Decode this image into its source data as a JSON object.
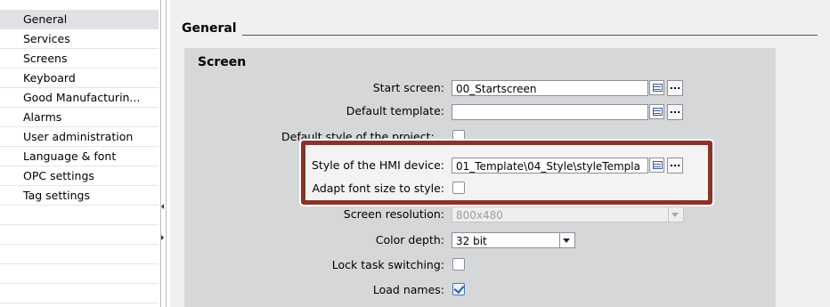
{
  "nav": {
    "items": [
      {
        "label": "General",
        "selected": true
      },
      {
        "label": "Services",
        "selected": false
      },
      {
        "label": "Screens",
        "selected": false
      },
      {
        "label": "Keyboard",
        "selected": false
      },
      {
        "label": "Good Manufacturin...",
        "selected": false
      },
      {
        "label": "Alarms",
        "selected": false
      },
      {
        "label": "User administration",
        "selected": false
      },
      {
        "label": "Language & font",
        "selected": false
      },
      {
        "label": "OPC settings",
        "selected": false
      },
      {
        "label": "Tag settings",
        "selected": false
      }
    ]
  },
  "content": {
    "section_title": "General",
    "panel_title": "Screen",
    "start_screen": {
      "label": "Start screen:",
      "value": "00_Startscreen"
    },
    "default_template": {
      "label": "Default template:",
      "value": ""
    },
    "default_style": {
      "label": "Default style of the project:",
      "checked": false
    },
    "style_hmi": {
      "label": "Style of the HMI device:",
      "value": "01_Template\\04_Style\\styleTempla"
    },
    "adapt_font": {
      "label": "Adapt font size to style:",
      "checked": false
    },
    "screen_resolution": {
      "label": "Screen resolution:",
      "value": "800x480",
      "disabled": true
    },
    "color_depth": {
      "label": "Color depth:",
      "value": "32 bit"
    },
    "lock_task": {
      "label": "Lock task switching:",
      "checked": false
    },
    "load_names": {
      "label": "Load names:",
      "checked": true
    },
    "dots_label": "..."
  },
  "colors": {
    "highlight_border": "#8a3228",
    "panel_bg": "#d6d7d9",
    "content_bg": "#f0f0f0"
  }
}
